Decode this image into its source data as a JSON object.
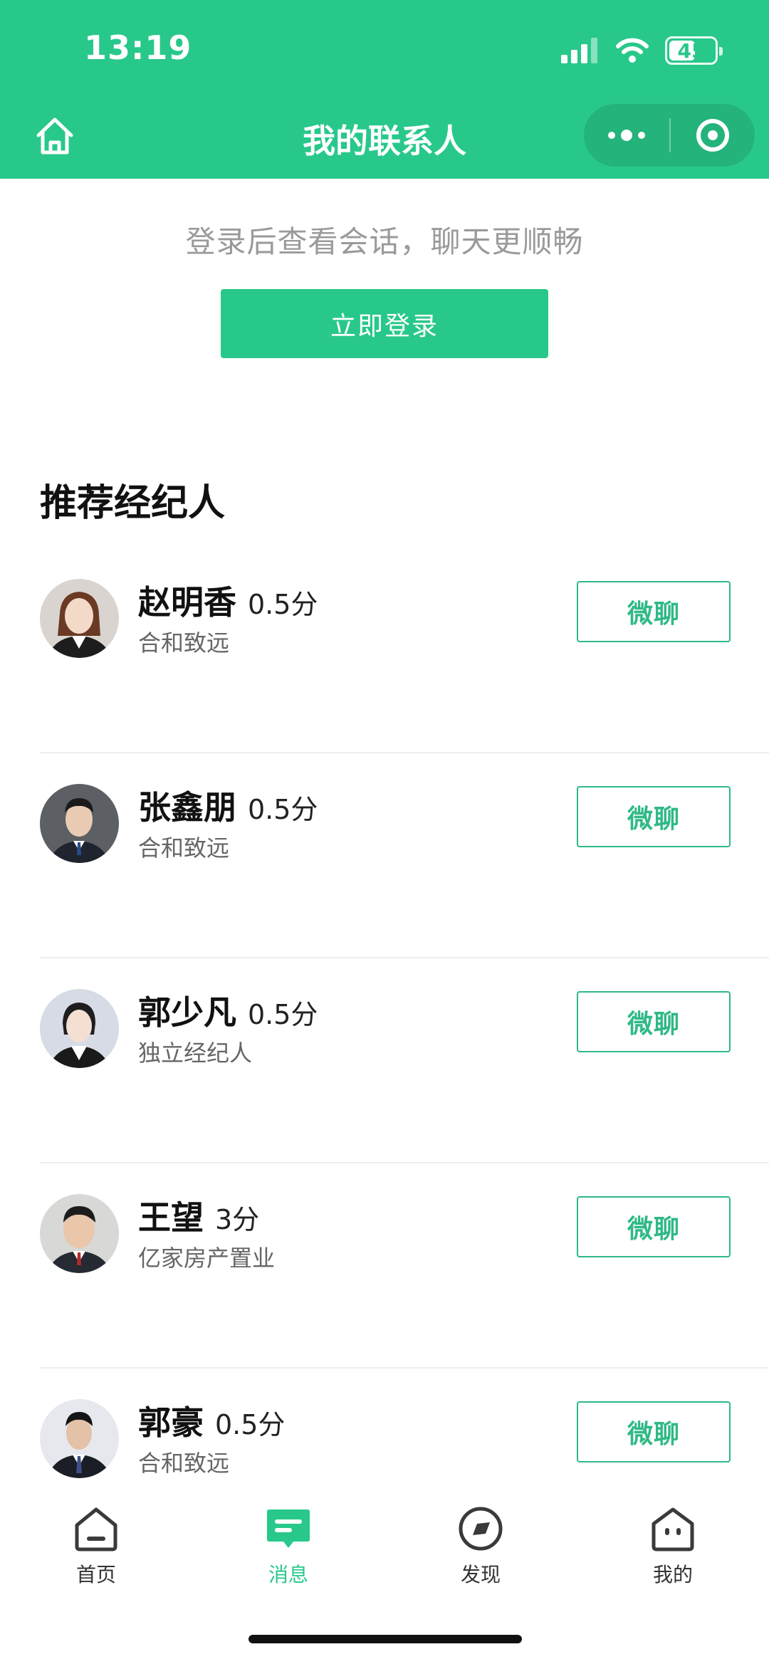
{
  "status_bar": {
    "time": "13:19",
    "battery": "45",
    "icons": [
      "signal-icon",
      "wifi-icon",
      "battery-icon"
    ]
  },
  "nav": {
    "title": "我的联系人",
    "home_icon": "home-icon",
    "more_icon": "more-dots-icon",
    "close_icon": "target-close-icon"
  },
  "login": {
    "hint": "登录后查看会话，聊天更顺畅",
    "button_label": "立即登录"
  },
  "section": {
    "title": "推荐经纪人"
  },
  "agents": [
    {
      "name": "赵明香",
      "score": "0.5分",
      "company": "合和致远",
      "chat_label": "微聊"
    },
    {
      "name": "张鑫朋",
      "score": "0.5分",
      "company": "合和致远",
      "chat_label": "微聊"
    },
    {
      "name": "郭少凡",
      "score": "0.5分",
      "company": "独立经纪人",
      "chat_label": "微聊"
    },
    {
      "name": "王望",
      "score": "3分",
      "company": "亿家房产置业",
      "chat_label": "微聊"
    },
    {
      "name": "郭豪",
      "score": "0.5分",
      "company": "合和致远",
      "chat_label": "微聊"
    }
  ],
  "tabbar": {
    "items": [
      {
        "label": "首页",
        "icon": "home-tab-icon",
        "active": false
      },
      {
        "label": "消息",
        "icon": "message-tab-icon",
        "active": true
      },
      {
        "label": "发现",
        "icon": "discover-tab-icon",
        "active": false
      },
      {
        "label": "我的",
        "icon": "profile-tab-icon",
        "active": false
      }
    ]
  },
  "colors": {
    "brand_green": "#28c88a",
    "button_border_green": "#2fb985",
    "tab_inactive": "#333333"
  }
}
